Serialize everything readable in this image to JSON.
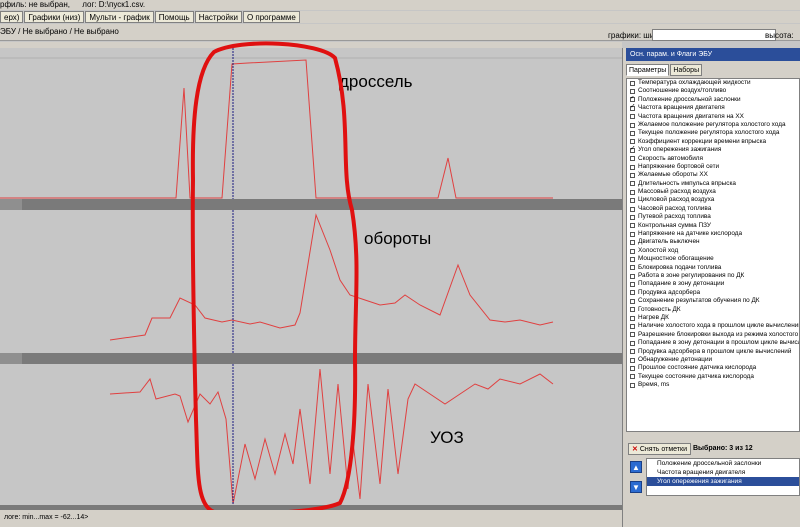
{
  "topbar": {
    "left_label": "рфиль: не выбран,",
    "log_label": "лог: D:\\пуск1.csv."
  },
  "tabs": [
    "ерх)",
    "Графики (низ)",
    "Мульти - график",
    "Помощь",
    "Настройки",
    "О программе"
  ],
  "toolbar": {
    "mode_label": "ЭБУ / Не выбрано / Не выбрано",
    "graph_width_label": "графики:  ширина:",
    "height_label": "высота:"
  },
  "plots": [
    {
      "label": "дроссель"
    },
    {
      "label": "обороты"
    },
    {
      "label": "УОЗ"
    }
  ],
  "right_panel": {
    "header": "Осн. парам. и Флаги ЭБУ",
    "tabs": [
      "Параметры",
      "Наборы"
    ],
    "params": [
      {
        "label": "Температура охлаждающей жидкости",
        "checked": false
      },
      {
        "label": "Соотношение воздух/топливо",
        "checked": false
      },
      {
        "label": "Положение дроссельной заслонки",
        "checked": true
      },
      {
        "label": "Частота вращения двигателя",
        "checked": true
      },
      {
        "label": "Частота вращения двигателя на ХХ",
        "checked": false
      },
      {
        "label": "Желаемое положение регулятора холостого хода",
        "checked": false
      },
      {
        "label": "Текущее положение регулятора холостого хода",
        "checked": false
      },
      {
        "label": "Коэффициент коррекции времени впрыска",
        "checked": false
      },
      {
        "label": "Угол опережения зажигания",
        "checked": true
      },
      {
        "label": "Скорость автомобиля",
        "checked": false
      },
      {
        "label": "Напряжение бортовой сети",
        "checked": false
      },
      {
        "label": "Желаемые обороты ХХ",
        "checked": false
      },
      {
        "label": "Длительность импульса впрыска",
        "checked": false
      },
      {
        "label": "Массовый расход воздуха",
        "checked": false
      },
      {
        "label": "Цикловой расход воздуха",
        "checked": false
      },
      {
        "label": "Часовой расход топлива",
        "checked": false
      },
      {
        "label": "Путевой расход топлива",
        "checked": false
      },
      {
        "label": "Контрольная сумма ПЗУ",
        "checked": false
      },
      {
        "label": "Напряжение на датчике кислорода",
        "checked": false
      },
      {
        "label": "Двигатель выключен",
        "checked": false
      },
      {
        "label": "Холостой ход",
        "checked": false
      },
      {
        "label": "Мощностное обогащение",
        "checked": false
      },
      {
        "label": "Блокировка подачи топлива",
        "checked": false
      },
      {
        "label": "Работа в зоне регулирования по ДК",
        "checked": false
      },
      {
        "label": "Попадание в зону детонации",
        "checked": false
      },
      {
        "label": "Продувка адсорбера",
        "checked": false
      },
      {
        "label": "Сохранение результатов обучения по ДК",
        "checked": false
      },
      {
        "label": "Готовность ДК",
        "checked": false
      },
      {
        "label": "Нагрев ДК",
        "checked": false
      },
      {
        "label": "Наличие холостого хода в прошлом цикле вычислений",
        "checked": false
      },
      {
        "label": "Разрешение блокировки выхода из режима холостого хода",
        "checked": false
      },
      {
        "label": "Попадание в зону детонации в прошлом цикле вычислений",
        "checked": false
      },
      {
        "label": "Продувка адсорбера в прошлом цикле вычислений",
        "checked": false
      },
      {
        "label": "Обнаружение детонации",
        "checked": false
      },
      {
        "label": "Прошлое состояние датчика кислорода",
        "checked": false
      },
      {
        "label": "Текущее состояние датчика кислорода",
        "checked": false
      },
      {
        "label": "Время, ms",
        "checked": false
      }
    ],
    "clear_button": "Снять отметки",
    "selected_count": "Выбрано: 3 из 12",
    "selected": [
      "Положение дроссельной заслонки",
      "Частота вращения двигателя",
      "Угол опережения зажигания"
    ]
  },
  "footer": {
    "text": "логе: min...max = -62...14>"
  },
  "colors": {
    "trace": "#e04040",
    "cursor_line": "#1a1a80",
    "annotation_oval": "#e01010",
    "selection": "#2b4e9a"
  }
}
